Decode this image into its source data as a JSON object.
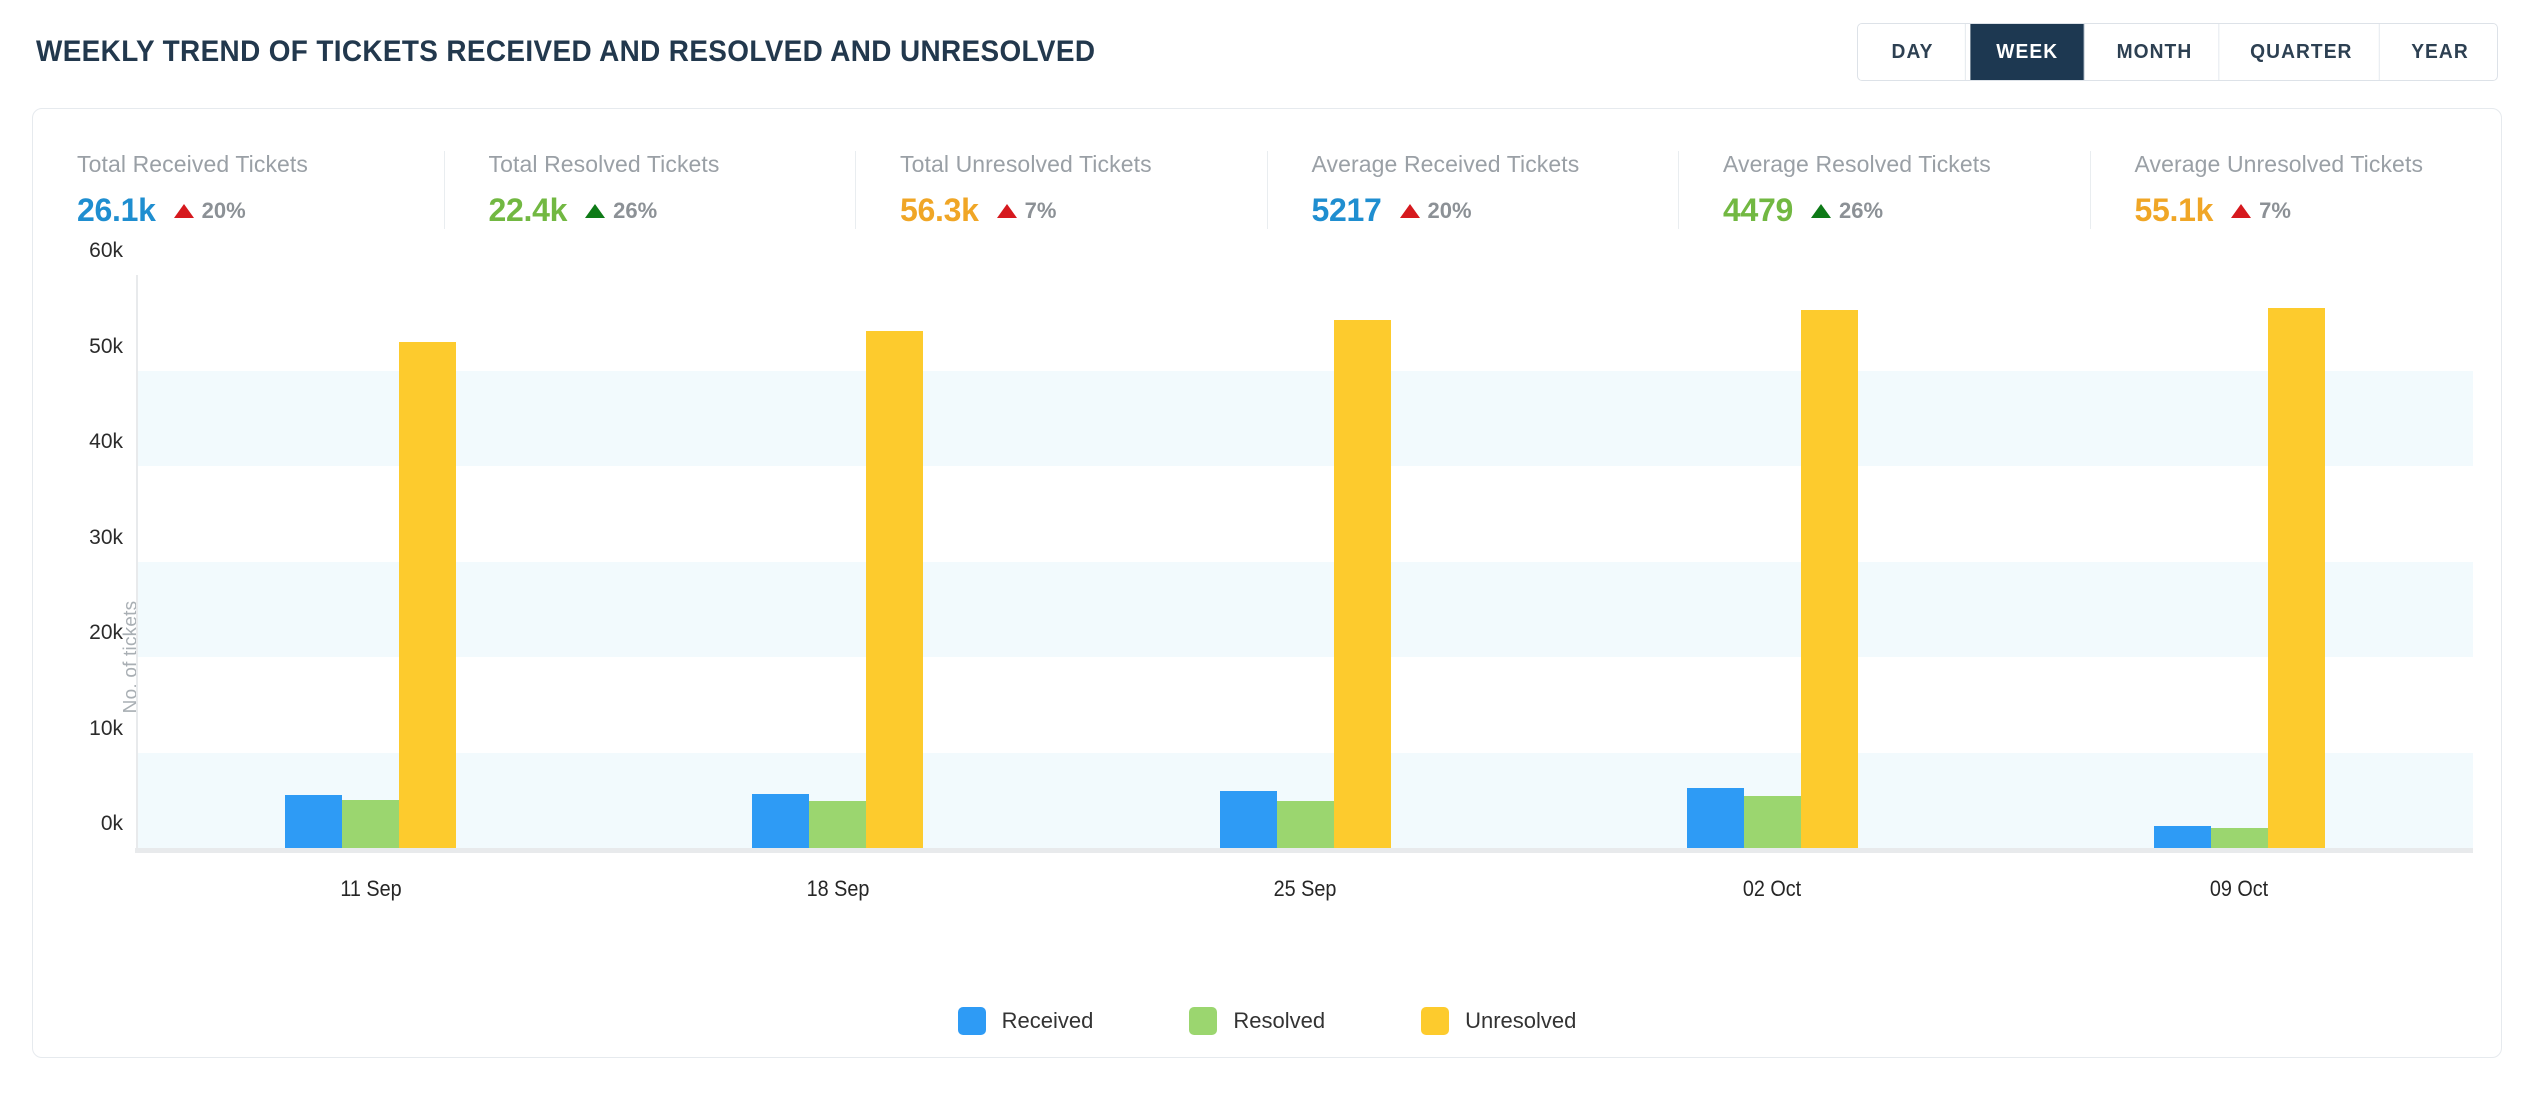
{
  "header": {
    "title": "WEEKLY TREND OF TICKETS RECEIVED AND RESOLVED AND UNRESOLVED",
    "period_toggle": [
      {
        "label": "DAY",
        "active": false
      },
      {
        "label": "WEEK",
        "active": true
      },
      {
        "label": "MONTH",
        "active": false
      },
      {
        "label": "QUARTER",
        "active": false
      },
      {
        "label": "YEAR",
        "active": false
      }
    ]
  },
  "kpis": [
    {
      "label": "Total Received Tickets",
      "value": "26.1k",
      "value_color": "#1f8ed0",
      "delta": "20%",
      "delta_direction": "up",
      "delta_color": "#d6191e"
    },
    {
      "label": "Total Resolved Tickets",
      "value": "22.4k",
      "value_color": "#72b842",
      "delta": "26%",
      "delta_direction": "up",
      "delta_color": "#0e7a17"
    },
    {
      "label": "Total Unresolved Tickets",
      "value": "56.3k",
      "value_color": "#f0a626",
      "delta": "7%",
      "delta_direction": "up",
      "delta_color": "#d6191e"
    },
    {
      "label": "Average Received Tickets",
      "value": "5217",
      "value_color": "#1f8ed0",
      "delta": "20%",
      "delta_direction": "up",
      "delta_color": "#d6191e"
    },
    {
      "label": "Average Resolved Tickets",
      "value": "4479",
      "value_color": "#72b842",
      "delta": "26%",
      "delta_direction": "up",
      "delta_color": "#0e7a17"
    },
    {
      "label": "Average Unresolved Tickets",
      "value": "55.1k",
      "value_color": "#f0a626",
      "delta": "7%",
      "delta_direction": "up",
      "delta_color": "#d6191e"
    }
  ],
  "chart_data": {
    "type": "bar",
    "title": "",
    "xlabel": "",
    "ylabel": "No. of tickets",
    "categories": [
      "11 Sep",
      "18 Sep",
      "25 Sep",
      "02 Oct",
      "09 Oct"
    ],
    "series": [
      {
        "name": "Received",
        "color": "#2e9bf5",
        "values": [
          5600,
          5700,
          6000,
          6300,
          2300
        ]
      },
      {
        "name": "Resolved",
        "color": "#9bd66f",
        "values": [
          5000,
          4900,
          4900,
          5400,
          2100
        ]
      },
      {
        "name": "Unresolved",
        "color": "#fdcb2d",
        "values": [
          53000,
          54100,
          55300,
          56300,
          56500
        ]
      }
    ],
    "ylim": [
      0,
      60000
    ],
    "ytick_values": [
      0,
      10000,
      20000,
      30000,
      40000,
      50000,
      60000
    ],
    "ytick_labels": [
      "0k",
      "10k",
      "20k",
      "30k",
      "40k",
      "50k",
      "60k"
    ],
    "grid": "alternating-horizontal-bands",
    "band_color": "#f2fafd",
    "band_ranges": [
      [
        0,
        10000
      ],
      [
        20000,
        30000
      ],
      [
        40000,
        50000
      ]
    ],
    "legend_position": "bottom-center"
  }
}
